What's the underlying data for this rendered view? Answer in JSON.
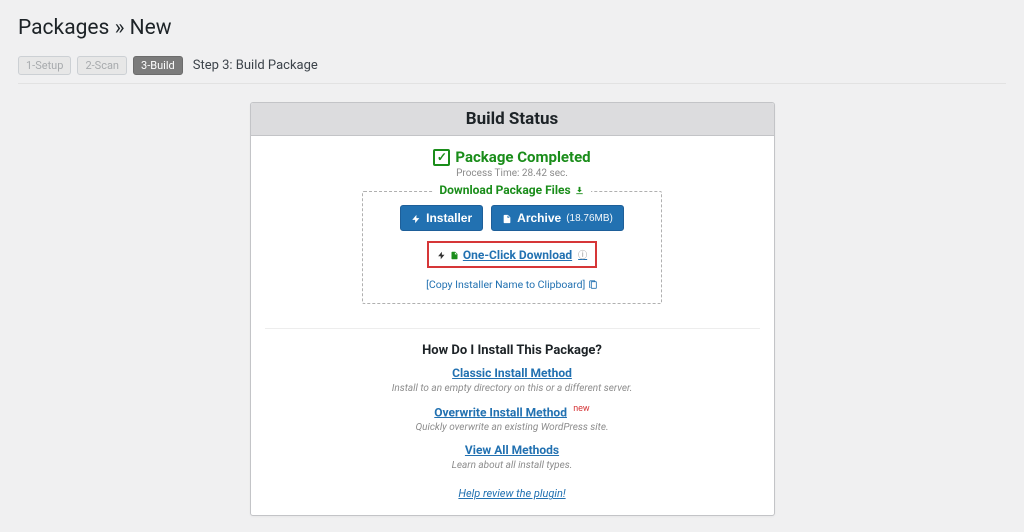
{
  "page": {
    "title": "Packages » New"
  },
  "steps": {
    "s1": "1-Setup",
    "s2": "2-Scan",
    "s3": "3-Build",
    "label": "Step 3: Build Package"
  },
  "panel": {
    "title": "Build Status",
    "status": "Package Completed",
    "process_time": "Process Time: 28.42 sec.",
    "download_legend": "Download Package Files",
    "installer_btn": "Installer",
    "archive_btn": "Archive",
    "archive_size": "(18.76MB)",
    "one_click": "One-Click Download",
    "copy_installer": "[Copy Installer Name to Clipboard]",
    "install_head": "How Do I Install This Package?",
    "classic": "Classic Install Method",
    "classic_sub": "Install to an empty directory on this or a different server.",
    "overwrite": "Overwrite Install Method",
    "overwrite_tag": "new",
    "overwrite_sub": "Quickly overwrite an existing WordPress site.",
    "viewall": "View All Methods",
    "viewall_sub": "Learn about all install types.",
    "review": "Help review the plugin!"
  }
}
